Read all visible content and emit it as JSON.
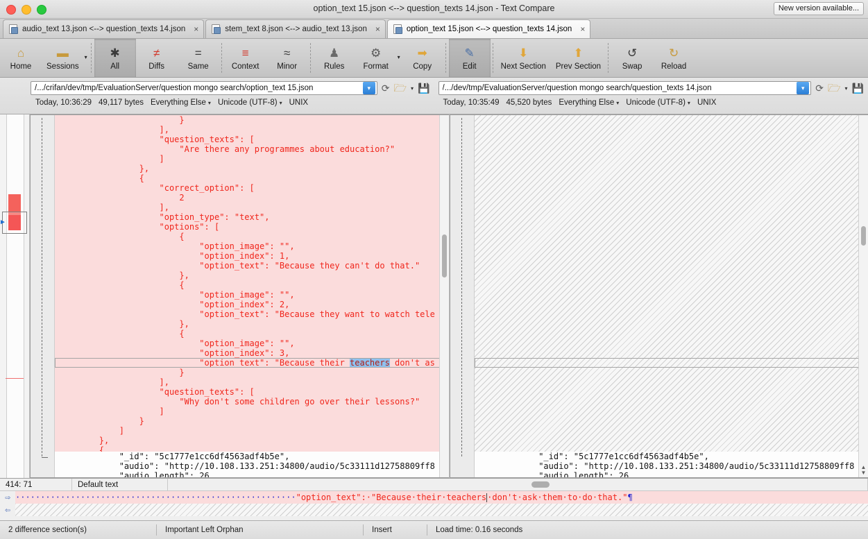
{
  "window": {
    "title": "option_text 15.json <--> question_texts 14.json - Text Compare",
    "new_version_label": "New version available..."
  },
  "tabs": [
    {
      "label": "audio_text 13.json <--> question_texts 14.json",
      "close": "×",
      "active": false
    },
    {
      "label": "stem_text 8.json <--> audio_text 13.json",
      "close": "×",
      "active": false
    },
    {
      "label": "option_text 15.json <--> question_texts 14.json",
      "close": "×",
      "active": true
    }
  ],
  "toolbar": [
    {
      "label": "Home",
      "icon": "home-icon",
      "glyph": "⌂",
      "color": "#c79a3d",
      "caret": false,
      "selected": false
    },
    {
      "label": "Sessions",
      "icon": "briefcase-icon",
      "glyph": "▬",
      "color": "#c79a3d",
      "caret": true,
      "selected": false
    },
    {
      "label": "All",
      "icon": "asterisk-icon",
      "glyph": "✱",
      "color": "#3a3a3a",
      "caret": false,
      "selected": true
    },
    {
      "label": "Diffs",
      "icon": "not-equal-icon",
      "glyph": "≠",
      "color": "#d23b2e",
      "caret": false,
      "selected": false
    },
    {
      "label": "Same",
      "icon": "equals-icon",
      "glyph": "=",
      "color": "#3a3a3a",
      "caret": false,
      "selected": false
    },
    {
      "label": "Context",
      "icon": "context-icon",
      "glyph": "≡",
      "color": "#d23b2e",
      "caret": false,
      "selected": false
    },
    {
      "label": "Minor",
      "icon": "approx-equal-icon",
      "glyph": "≈",
      "color": "#3a3a3a",
      "caret": false,
      "selected": false
    },
    {
      "label": "Rules",
      "icon": "referee-icon",
      "glyph": "♟",
      "color": "#6a6a6a",
      "caret": false,
      "selected": false
    },
    {
      "label": "Format",
      "icon": "format-gear-doc-icon",
      "glyph": "⚙",
      "color": "#5a5a5a",
      "caret": true,
      "selected": false
    },
    {
      "label": "Copy",
      "icon": "copy-arrow-icon",
      "glyph": "➡",
      "color": "#e0a63a",
      "caret": false,
      "selected": false
    },
    {
      "label": "Edit",
      "icon": "edit-pencil-icon",
      "glyph": "✎",
      "color": "#4a6fa5",
      "caret": false,
      "selected": true
    },
    {
      "label": "Next Section",
      "icon": "arrow-down-icon",
      "glyph": "⬇",
      "color": "#e0a63a",
      "caret": false,
      "selected": false
    },
    {
      "label": "Prev Section",
      "icon": "arrow-up-icon",
      "glyph": "⬆",
      "color": "#e0a63a",
      "caret": false,
      "selected": false
    },
    {
      "label": "Swap",
      "icon": "swap-icon",
      "glyph": "↺",
      "color": "#3a3a3a",
      "caret": false,
      "selected": false
    },
    {
      "label": "Reload",
      "icon": "reload-hand-icon",
      "glyph": "↻",
      "color": "#c79a3d",
      "caret": false,
      "selected": false
    }
  ],
  "left_pane": {
    "path": "/.../crifan/dev/tmp/EvaluationServer/question mongo search/option_text 15.json",
    "dropdown_glyph": "▾",
    "refresh_icon": "refresh-icon",
    "browse_icon": "folder-open-icon",
    "save_icon": "save-disk-icon",
    "meta": {
      "timestamp": "Today, 10:36:29",
      "size": "49,117 bytes",
      "rules": "Everything Else",
      "encoding": "Unicode (UTF-8)",
      "line_endings": "UNIX"
    },
    "diff_lines": [
      "                        }",
      "                    ],",
      "                    \"question_texts\": [",
      "                        \"Are there any programmes about education?\"",
      "                    ]",
      "                },",
      "                {",
      "                    \"correct_option\": [",
      "                        2",
      "                    ],",
      "                    \"option_type\": \"text\",",
      "                    \"options\": [",
      "                        {",
      "                            \"option_image\": \"\",",
      "                            \"option_index\": 1,",
      "                            \"option_text\": \"Because they can't do that.\"",
      "                        },",
      "                        {",
      "                            \"option_image\": \"\",",
      "                            \"option_index\": 2,",
      "                            \"option_text\": \"Because they want to watch tele",
      "                        },",
      "                        {",
      "                            \"option_image\": \"\",",
      "                            \"option_index\": 3,"
    ],
    "cursor_line_prefix": "                            \"option_text\": \"Because their ",
    "cursor_line_selected": "teachers",
    "cursor_line_suffix": " don't as",
    "diff_lines_after": [
      "                        }",
      "                    ],",
      "                    \"question_texts\": [",
      "                        \"Why don't some children go over their lessons?\"",
      "                    ]",
      "                }",
      "            ]",
      "        },",
      "        {"
    ],
    "normal_lines": [
      "            \"_id\": \"5c1777e1cc6df4563adf4b5e\",",
      "            \"audio\": \"http://10.108.133.251:34800/audio/5c33111d12758809ff8",
      "            \"audio_length\": 26"
    ]
  },
  "right_pane": {
    "path": "/.../dev/tmp/EvaluationServer/question mongo search/question_texts 14.json",
    "dropdown_glyph": "▾",
    "refresh_icon": "refresh-icon",
    "browse_icon": "folder-open-icon",
    "save_icon": "save-disk-icon",
    "meta": {
      "timestamp": "Today, 10:35:49",
      "size": "45,520 bytes",
      "rules": "Everything Else",
      "encoding": "Unicode (UTF-8)",
      "line_endings": "UNIX"
    },
    "normal_lines": [
      "            \"_id\": \"5c1777e1cc6df4563adf4b5e\",",
      "            \"audio\": \"http://10.108.133.251:34800/audio/5c33111d12758809ff8",
      "            \"audio_length\": 26"
    ]
  },
  "editor": {
    "position": "414: 71",
    "style": "Default text",
    "line_prefix_dots": "····························",
    "line_text_a": "\"option_text\":·\"Because·their·teachers",
    "line_text_b": "·don't·ask·them·to·do·that.\"",
    "pilcrow": "¶",
    "arrow_right": "⇨",
    "arrow_left": "⇦"
  },
  "statusbar": {
    "differences": "2 difference section(s)",
    "orphan": "Important Left Orphan",
    "mode": "Insert",
    "load_time": "Load time: 0.16 seconds"
  },
  "colors": {
    "diff_bg": "#fbdcdc",
    "diff_text": "#f0261c",
    "selection": "#8fc1ee",
    "accent_blue": "#2b7fd6",
    "overview_red": "#f01e1e"
  }
}
